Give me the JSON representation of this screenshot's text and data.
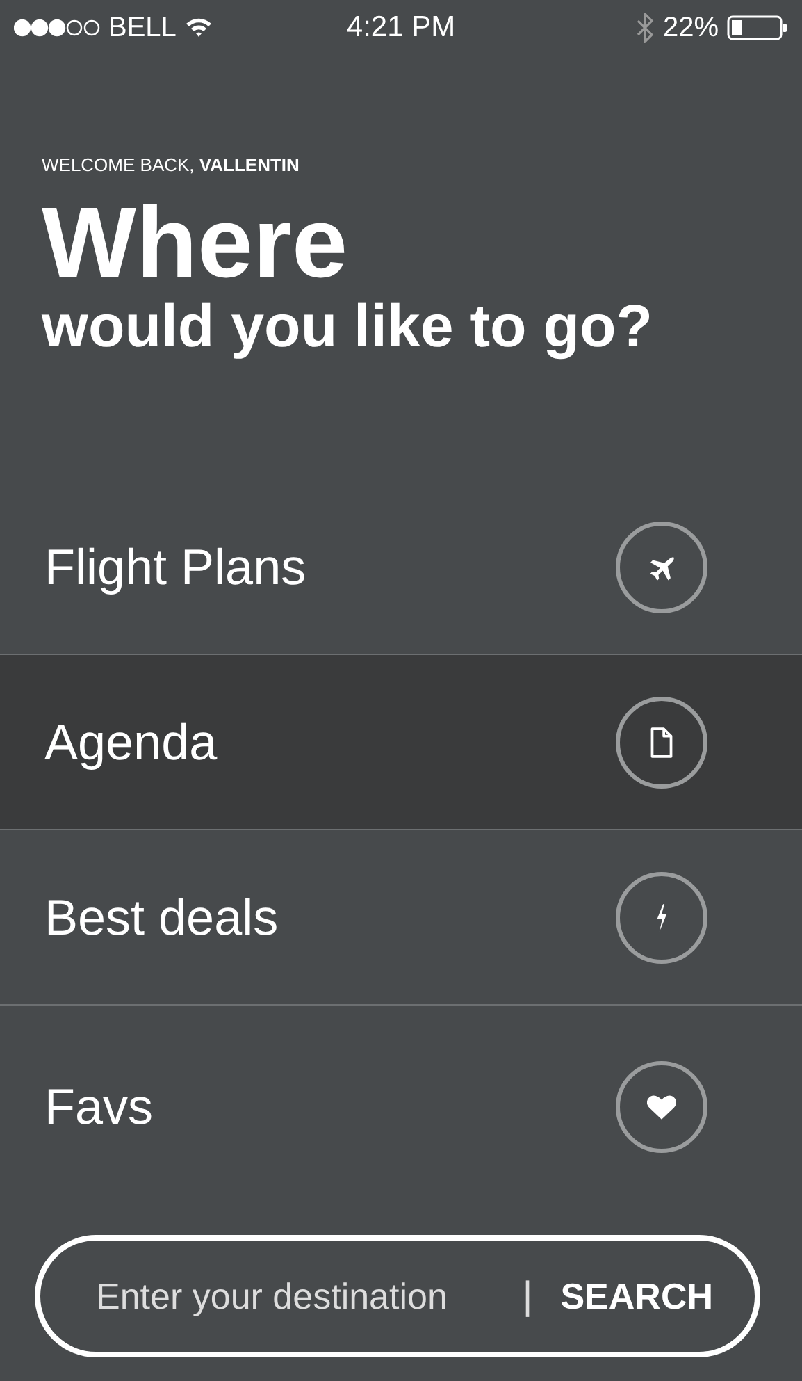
{
  "status_bar": {
    "carrier": "BELL",
    "time": "4:21 PM",
    "battery": "22%"
  },
  "greeting": "WELCOME BACK, **VALLENTIN**",
  "headline": "Where",
  "subheadline": "would you like to go?",
  "menu": [
    {
      "label": "Flight Plans",
      "kind": "plane",
      "selected": false
    },
    {
      "label": "Agenda",
      "kind": "document",
      "selected": true
    },
    {
      "label": "Best deals",
      "kind": "bolt",
      "selected": false
    },
    {
      "label": "Favs",
      "kind": "heart",
      "selected": false
    }
  ],
  "search": {
    "placeholder": "Enter your destination",
    "separator": "|",
    "button": "SEARCH"
  }
}
